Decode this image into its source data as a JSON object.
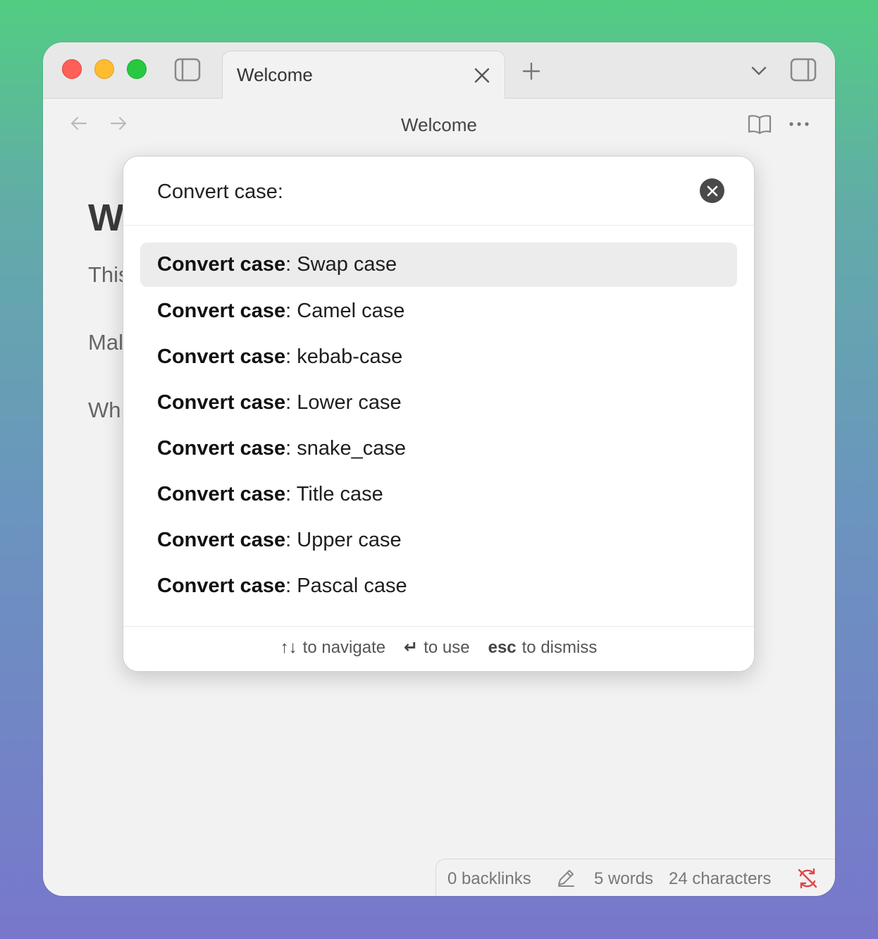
{
  "window": {
    "tab": {
      "title": "Welcome"
    },
    "nav": {
      "title": "Welcome"
    }
  },
  "note": {
    "heading": "W",
    "lines": [
      "This",
      "Mal",
      "Wh"
    ]
  },
  "modal": {
    "prompt": "Convert case:",
    "suggestions": [
      {
        "prefix": "Convert case",
        "label": "Swap case",
        "selected": true
      },
      {
        "prefix": "Convert case",
        "label": "Camel case"
      },
      {
        "prefix": "Convert case",
        "label": "kebab-case"
      },
      {
        "prefix": "Convert case",
        "label": "Lower case"
      },
      {
        "prefix": "Convert case",
        "label": "snake_case"
      },
      {
        "prefix": "Convert case",
        "label": "Title case"
      },
      {
        "prefix": "Convert case",
        "label": "Upper case"
      },
      {
        "prefix": "Convert case",
        "label": "Pascal case"
      }
    ],
    "hints": {
      "navigate_key": "↑↓",
      "navigate": "to navigate",
      "use_key": "↵",
      "use": "to use",
      "dismiss_key": "esc",
      "dismiss": "to dismiss"
    }
  },
  "statusbar": {
    "backlinks": "0 backlinks",
    "words": "5 words",
    "characters": "24 characters"
  },
  "colors": {
    "accent_sync_error": "#e0464a",
    "traffic_red": "#fe5f57",
    "traffic_yellow": "#febc2e",
    "traffic_green": "#28c840"
  }
}
